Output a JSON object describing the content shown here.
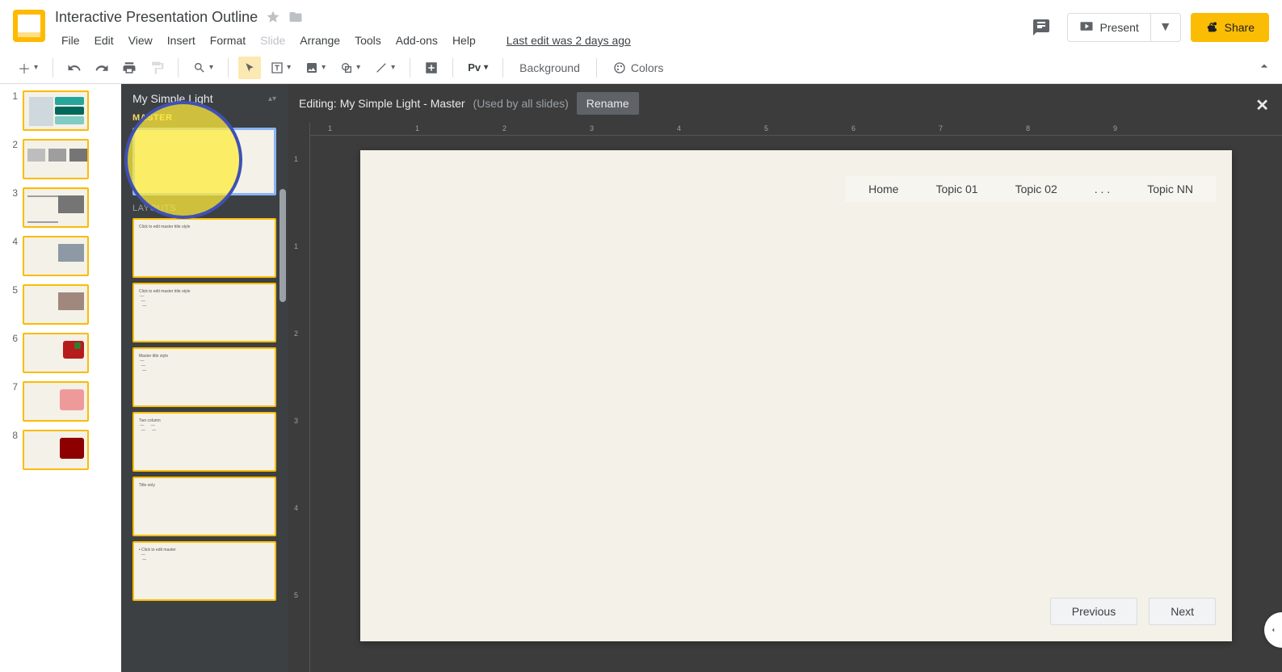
{
  "doc": {
    "title": "Interactive Presentation Outline"
  },
  "menu": {
    "file": "File",
    "edit": "Edit",
    "view": "View",
    "insert": "Insert",
    "format": "Format",
    "slide": "Slide",
    "arrange": "Arrange",
    "tools": "Tools",
    "addons": "Add-ons",
    "help": "Help"
  },
  "last_edit": "Last edit was 2 days ago",
  "buttons": {
    "present": "Present",
    "share": "Share"
  },
  "toolbar": {
    "background": "Background",
    "colors": "Colors",
    "transition_label_abbrev": "Pv"
  },
  "master": {
    "theme_name": "My Simple Light",
    "label_master": "MASTER",
    "label_layouts": "LAYOUTS"
  },
  "editor": {
    "prefix": "Editing:",
    "theme_master": "My Simple Light - Master",
    "used_by": "(Used by all slides)",
    "rename": "Rename"
  },
  "ruler_ticks": [
    "1",
    "",
    "1",
    "2",
    "3",
    "4",
    "5",
    "6",
    "7",
    "8",
    "9"
  ],
  "canvas": {
    "nav": {
      "home": "Home",
      "t1": "Topic 01",
      "t2": "Topic 02",
      "dots": ". . .",
      "tn": "Topic NN"
    },
    "prev": "Previous",
    "next": "Next"
  },
  "slides": [
    1,
    2,
    3,
    4,
    5,
    6,
    7,
    8
  ]
}
